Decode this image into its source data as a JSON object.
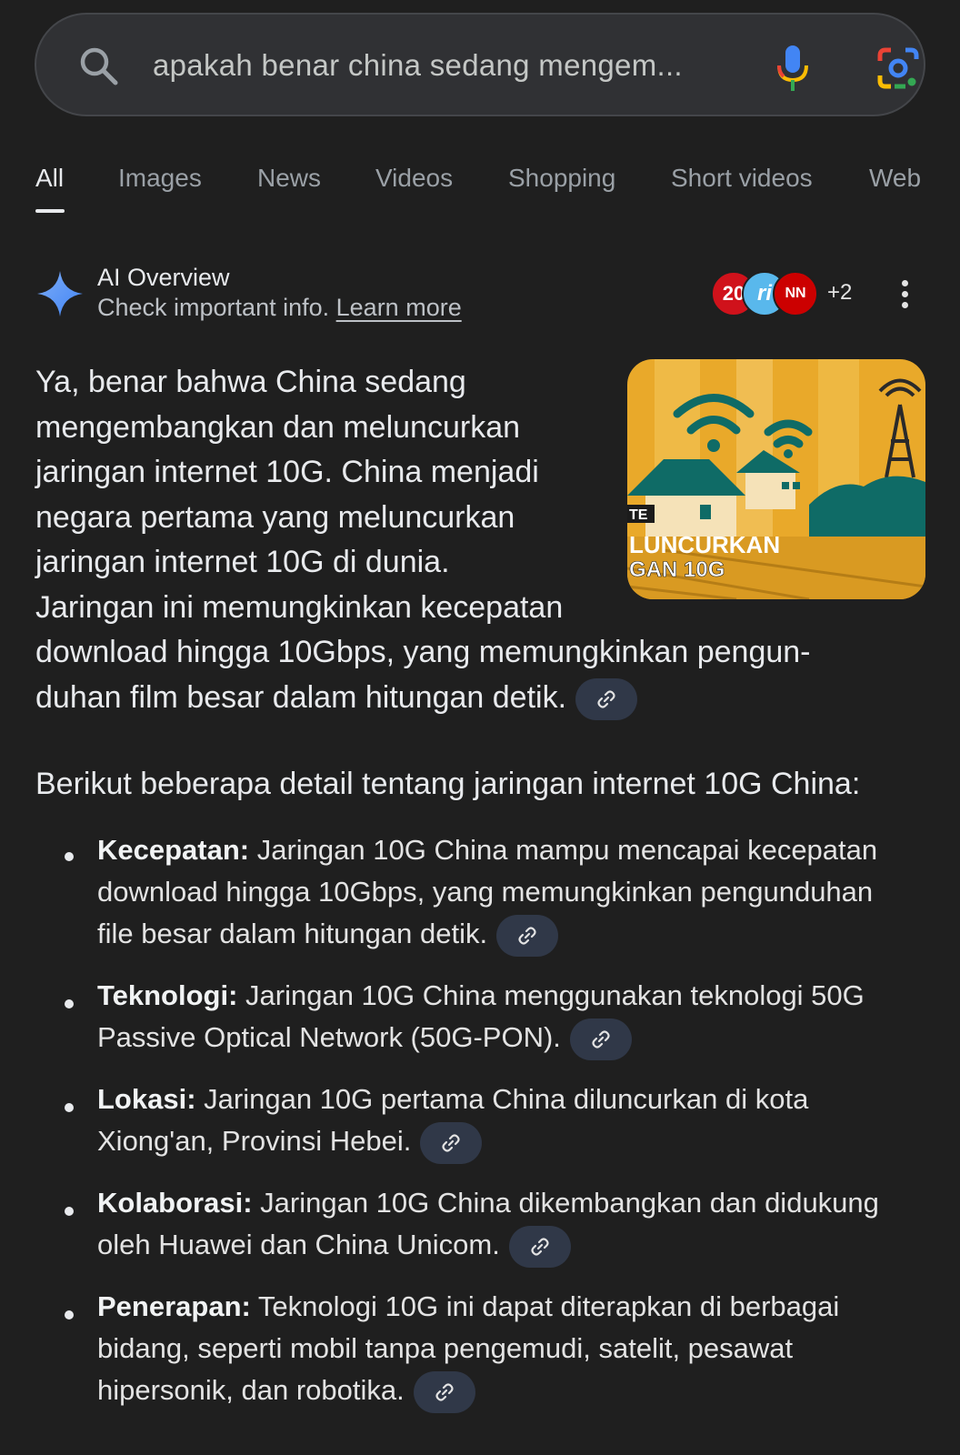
{
  "search": {
    "query": "apakah benar china sedang mengem...",
    "icons": {
      "search": "search-icon",
      "voice": "microphone-icon",
      "lens": "google-lens-icon"
    }
  },
  "tabs": [
    {
      "label": "All",
      "active": true
    },
    {
      "label": "Images"
    },
    {
      "label": "News"
    },
    {
      "label": "Videos"
    },
    {
      "label": "Shopping"
    },
    {
      "label": "Short videos"
    },
    {
      "label": "Web"
    }
  ],
  "ai_overview": {
    "title": "AI Overview",
    "subtitle": "Check important info.",
    "learn_more": "Learn more",
    "sources": [
      "20",
      "ri",
      "NN"
    ],
    "sources_more": "+2",
    "image_caption_lines": [
      "LUNCURKAN",
      "GAN 10G"
    ],
    "paragraph_lines": [
      "Ya, benar bahwa China sedang",
      "mengembangkan dan meluncurkan",
      "jaringan internet 10G. China menjadi",
      "negara pertama yang meluncurkan",
      "jaringan internet 10G di dunia.",
      "Jaringan ini memungkinkan kecepatan",
      "download hingga 10Gbps, yang memungkinkan pengun-",
      "duhan film besar dalam hitungan detik."
    ],
    "intro": "Berikut beberapa detail tentang jaringan internet 10G China:",
    "bullets": [
      {
        "label": "Kecepatan:",
        "lines": [
          " Jaringan 10G China mampu mencapai kecepatan",
          "download hingga 10Gbps, yang memungkinkan pengunduhan",
          "file besar dalam hitungan detik."
        ]
      },
      {
        "label": "Teknologi:",
        "lines": [
          " Jaringan 10G China menggunakan teknologi 50G",
          "Passive Optical Network (50G-PON)."
        ]
      },
      {
        "label": "Lokasi:",
        "lines": [
          " Jaringan 10G pertama China diluncurkan di kota",
          "Xiong'an, Provinsi Hebei."
        ]
      },
      {
        "label": "Kolaborasi:",
        "lines": [
          " Jaringan 10G China dikembangkan dan didukung",
          "oleh Huawei dan China Unicom."
        ]
      },
      {
        "label": "Penerapan:",
        "lines": [
          " Teknologi 10G ini dapat diterapkan di berbagai",
          "bidang, seperti mobil tanpa pengemudi, satelit, pesawat",
          "hipersonik, dan robotika."
        ]
      }
    ]
  },
  "colors": {
    "background": "#1f1f1f",
    "link_chip": "#303848",
    "text": "#e8eaed"
  }
}
